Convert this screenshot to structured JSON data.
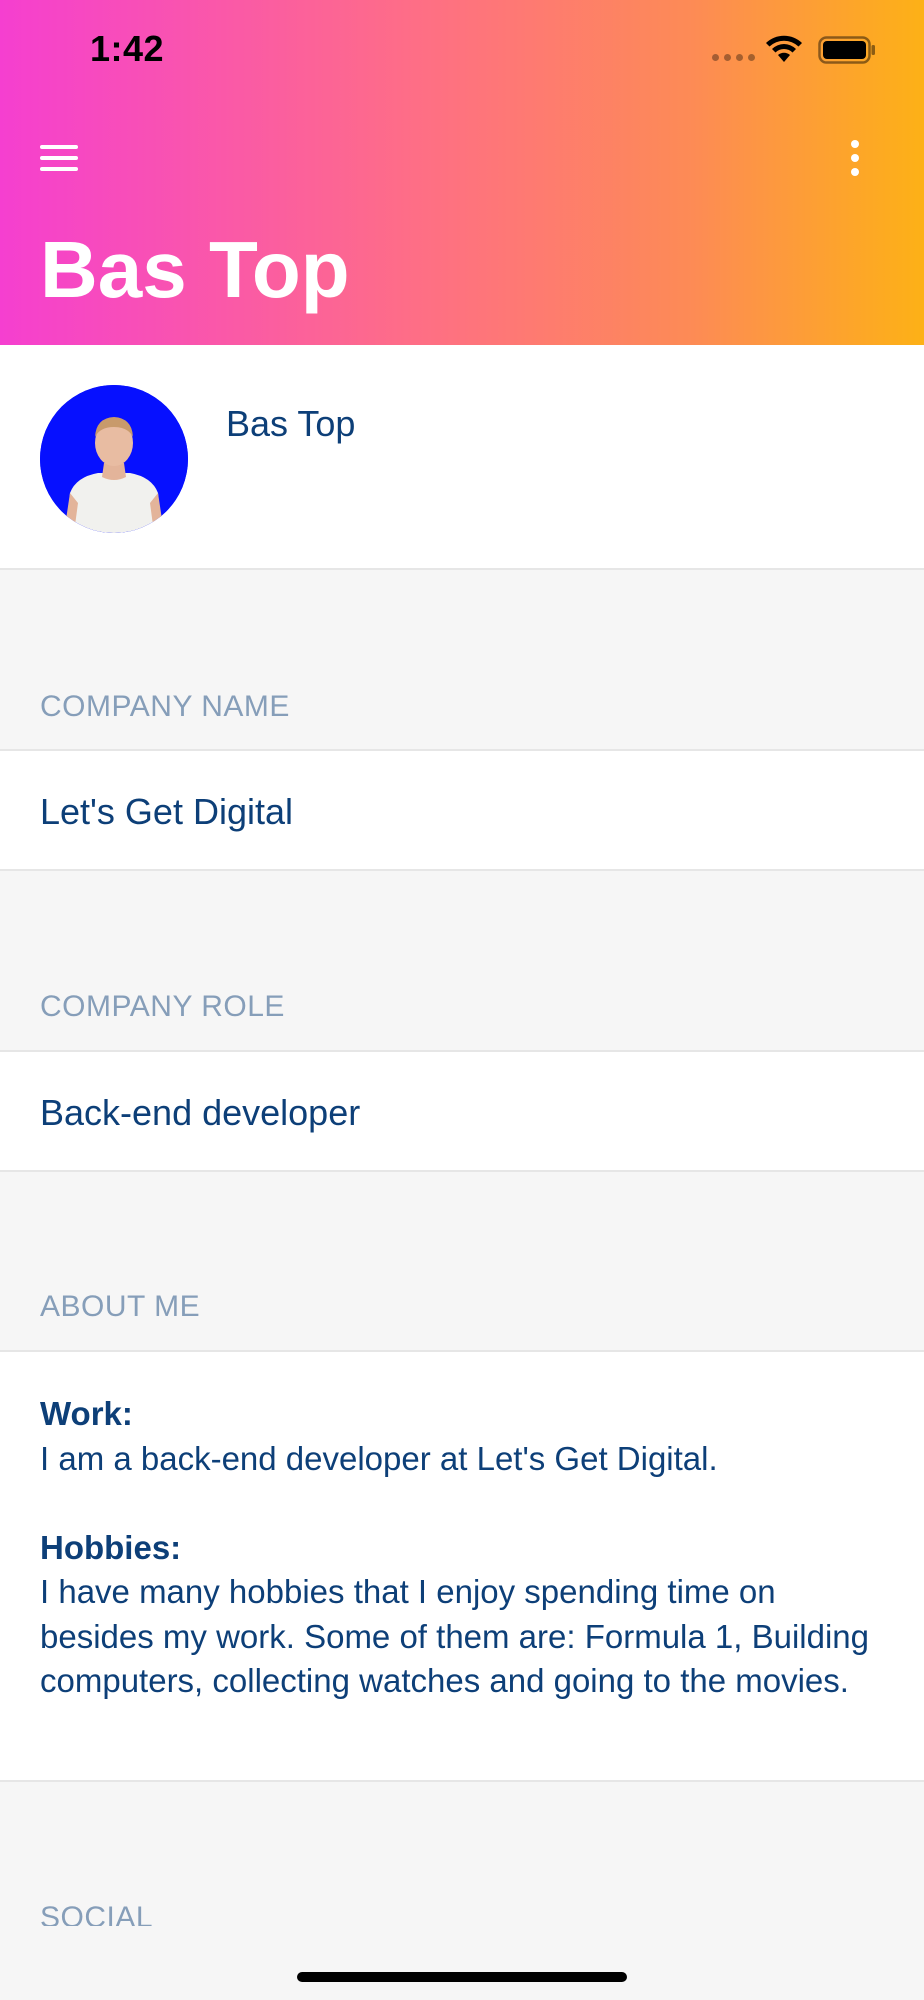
{
  "status_bar": {
    "time": "1:42",
    "signal_icon": "signal-dots-icon",
    "wifi_icon": "wifi-icon",
    "battery_icon": "battery-full-icon"
  },
  "header": {
    "title": "Bas Top",
    "menu_icon": "hamburger-menu-icon",
    "more_icon": "more-vertical-icon",
    "gradient_colors": [
      "#f53fd0",
      "#fe6e86",
      "#fd8b55",
      "#fdb116"
    ]
  },
  "profile": {
    "name": "Bas Top",
    "avatar_background": "#0610ff"
  },
  "sections": {
    "company_name": {
      "label": "COMPANY NAME",
      "value": "Let's Get Digital"
    },
    "company_role": {
      "label": "COMPANY ROLE",
      "value": "Back-end developer"
    },
    "about_me": {
      "label": "ABOUT ME",
      "work_heading": "Work:",
      "work_text": "I am a back-end developer at Let's Get Digital.",
      "hobbies_heading": "Hobbies:",
      "hobbies_text": "I have many hobbies that I enjoy spending time on besides my work. Some of them are: Formula 1, Building computers, collecting watches and going to the movies."
    },
    "social": {
      "label": "SOCIAL"
    }
  },
  "colors": {
    "text_primary": "#0d3f78",
    "label": "#869eb9",
    "background": "#f6f6f6"
  }
}
